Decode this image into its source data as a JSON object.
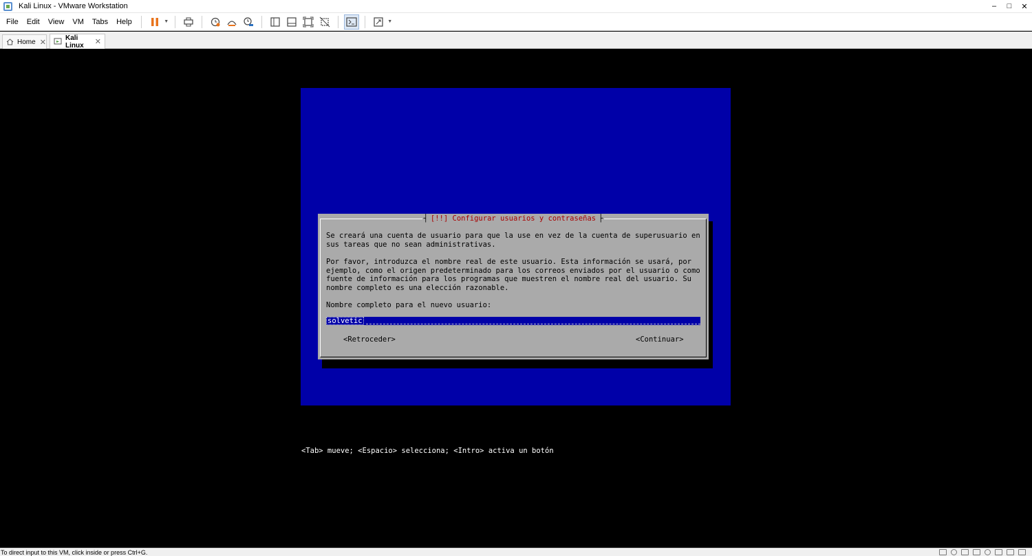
{
  "window": {
    "title": "Kali Linux - VMware Workstation",
    "controls": {
      "minimize": "–",
      "maximize": "□",
      "close": "✕"
    }
  },
  "menu": {
    "items": [
      "File",
      "Edit",
      "View",
      "VM",
      "Tabs",
      "Help"
    ]
  },
  "toolbar": {
    "icons": [
      "pause-icon",
      "send-ctrl-alt-del-icon",
      "snapshot-icon",
      "revert-snapshot-icon",
      "snapshot-manager-icon",
      "library-icon",
      "thumbnail-bar-icon",
      "full-screen-icon",
      "unity-icon",
      "console-view-icon",
      "stretch-icon"
    ],
    "accent_color": "#e8731c"
  },
  "tabs": [
    {
      "label": "Home",
      "icon": "home-icon",
      "close": "✕",
      "active": false
    },
    {
      "label": "Kali Linux",
      "icon": "vm-icon",
      "close": "✕",
      "active": true
    }
  ],
  "installer": {
    "dialog_title": "[!!] Configurar usuarios y contraseñas",
    "paragraph_1": "Se creará una cuenta de usuario para que la use en vez de la cuenta de superusuario en\nsus tareas que no sean administrativas.",
    "paragraph_2": "Por favor, introduzca el nombre real de este usuario. Esta información se usará, por\nejemplo, como el origen predeterminado para los correos enviados por el usuario o como\nfuente de información para los programas que muestren el nombre real del usuario. Su\nnombre completo es una elección razonable.",
    "field_label": "Nombre completo para el nuevo usuario:",
    "field_value": "solvetic",
    "back_button": "<Retroceder>",
    "continue_button": "<Continuar>",
    "hint": "<Tab> mueve; <Espacio> selecciona; <Intro> activa un botón",
    "colors": {
      "background": "#0000a8",
      "dialog": "#aaaaaa",
      "title": "#a80000"
    }
  },
  "statusbar": {
    "text": "To direct input to this VM, click inside or press Ctrl+G.",
    "icons": [
      "hard-disk-icon",
      "cd-dvd-icon",
      "network-icon",
      "usb-icon",
      "sound-icon",
      "printer-icon",
      "display-icon",
      "message-icon"
    ]
  }
}
